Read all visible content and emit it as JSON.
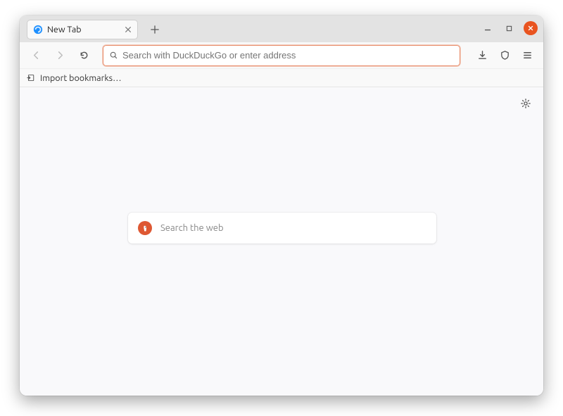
{
  "tab": {
    "title": "New Tab"
  },
  "urlbar": {
    "placeholder": "Search with DuckDuckGo or enter address",
    "value": ""
  },
  "bookmarks": {
    "import_label": "Import bookmarks…"
  },
  "newtab_page": {
    "search_placeholder": "Search the web"
  }
}
